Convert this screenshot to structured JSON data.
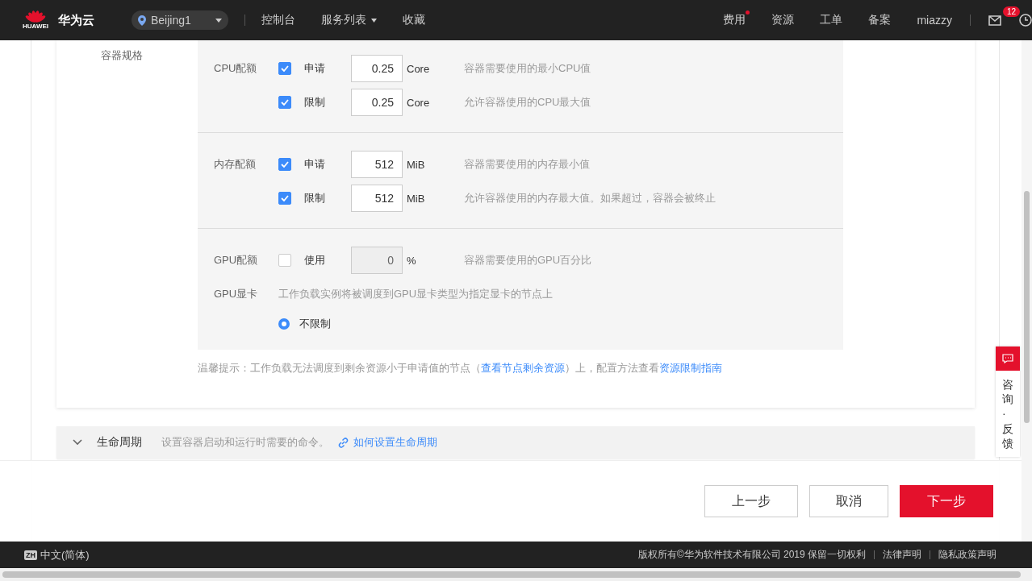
{
  "topbar": {
    "logo_text": "HUAWEI",
    "brand": "华为云",
    "region": "Beijing1",
    "nav": [
      {
        "label": "控制台",
        "dropdown": false
      },
      {
        "label": "服务列表",
        "dropdown": true
      },
      {
        "label": "收藏",
        "dropdown": false
      }
    ],
    "right_nav": [
      {
        "label": "费用",
        "dot": true
      },
      {
        "label": "资源",
        "dot": false
      },
      {
        "label": "工单",
        "dot": false
      },
      {
        "label": "备案",
        "dot": false
      },
      {
        "label": "miazzy",
        "dot": false
      }
    ],
    "mail_badge": "12"
  },
  "spec": {
    "label": "容器规格",
    "panels": [
      {
        "rows": [
          {
            "kind": "quota",
            "label": "CPU配额",
            "check_label": "申请",
            "checked": true,
            "value": "0.25",
            "unit": "Core",
            "disabled": false,
            "desc": "容器需要使用的最小CPU值"
          },
          {
            "kind": "quota",
            "check_label": "限制",
            "checked": true,
            "value": "0.25",
            "unit": "Core",
            "disabled": false,
            "desc": "允许容器使用的CPU最大值"
          }
        ]
      },
      {
        "rows": [
          {
            "kind": "quota",
            "label": "内存配额",
            "check_label": "申请",
            "checked": true,
            "value": "512",
            "unit": "MiB",
            "disabled": false,
            "desc": "容器需要使用的内存最小值"
          },
          {
            "kind": "quota",
            "check_label": "限制",
            "checked": true,
            "value": "512",
            "unit": "MiB",
            "disabled": false,
            "desc": "允许容器使用的内存最大值。如果超过，容器会被终止"
          }
        ]
      },
      {
        "rows": [
          {
            "kind": "quota",
            "label": "GPU配额",
            "check_label": "使用",
            "checked": false,
            "value": "0",
            "unit": "%",
            "disabled": true,
            "desc": "容器需要使用的GPU百分比"
          },
          {
            "kind": "text",
            "label": "GPU显卡",
            "text": "工作负载实例将被调度到GPU显卡类型为指定显卡的节点上"
          },
          {
            "kind": "radio",
            "option": "不限制",
            "selected": true
          }
        ]
      }
    ],
    "hint": [
      {
        "kind": "text",
        "text": "温馨提示：工作负载无法调度到剩余资源小于申请值的节点（"
      },
      {
        "kind": "link",
        "text": "查看节点剩余资源"
      },
      {
        "kind": "text",
        "text": "）上，配置方法查看"
      },
      {
        "kind": "link",
        "text": "资源限制指南"
      }
    ]
  },
  "sections": [
    {
      "title": "生命周期",
      "desc": "设置容器启动和运行时需要的命令。",
      "link": "如何设置生命周期"
    }
  ],
  "actions": [
    {
      "label": "上一步",
      "primary": false
    },
    {
      "label": "取消",
      "primary": false
    },
    {
      "label": "下一步",
      "primary": true
    }
  ],
  "feedback": "咨询·反馈",
  "footer": {
    "lang_badge": "ZH",
    "language": "中文(简体)",
    "copyright": "版权所有©华为软件技术有限公司 2019 保留一切权利",
    "links": [
      "法律声明",
      "隐私政策声明"
    ]
  }
}
